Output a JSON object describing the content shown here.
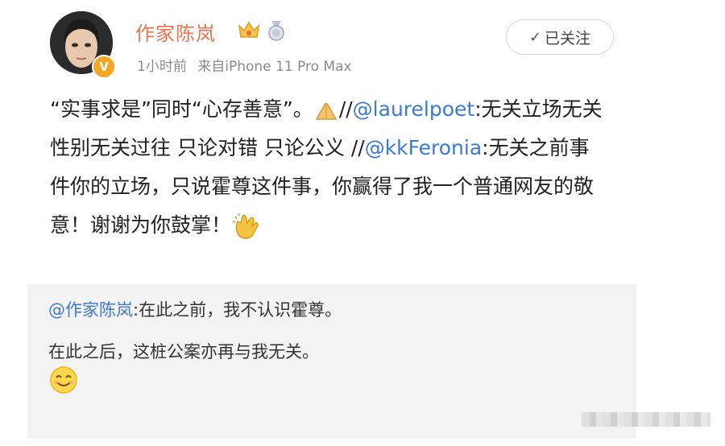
{
  "post": {
    "author": "作家陈岚",
    "time": "1小时前",
    "source": "来自iPhone 11 Pro Max",
    "follow_label": "已关注",
    "text_parts": {
      "p1": "“实事求是”同时“心存善意”。",
      "p2": "//",
      "m1": "@laurelpoet",
      "p3": ":无关立场无关性别无关过往 只论对错 只论公义 //",
      "m2": "@kkFeronia",
      "p4": ":无关之前事件你的立场，只说霍尊这件事，你赢得了我一个普通网友的敬意！谢谢为你鼓掌！"
    }
  },
  "repost": {
    "mention": "@作家陈岚",
    "line1_rest": ":在此之前，我不认识霍尊。",
    "line2": "在此之后，这桩公案亦再与我无关。"
  },
  "colors": {
    "username": "#eb7350",
    "mention": "#3d7ad1",
    "repost_bg": "#f3f3f3",
    "verified_badge": "#f5a623"
  },
  "icons": [
    "check-icon",
    "crown-icon",
    "medal-icon",
    "verified-icon",
    "pray-emoji",
    "clap-emoji",
    "smile-emoji"
  ]
}
